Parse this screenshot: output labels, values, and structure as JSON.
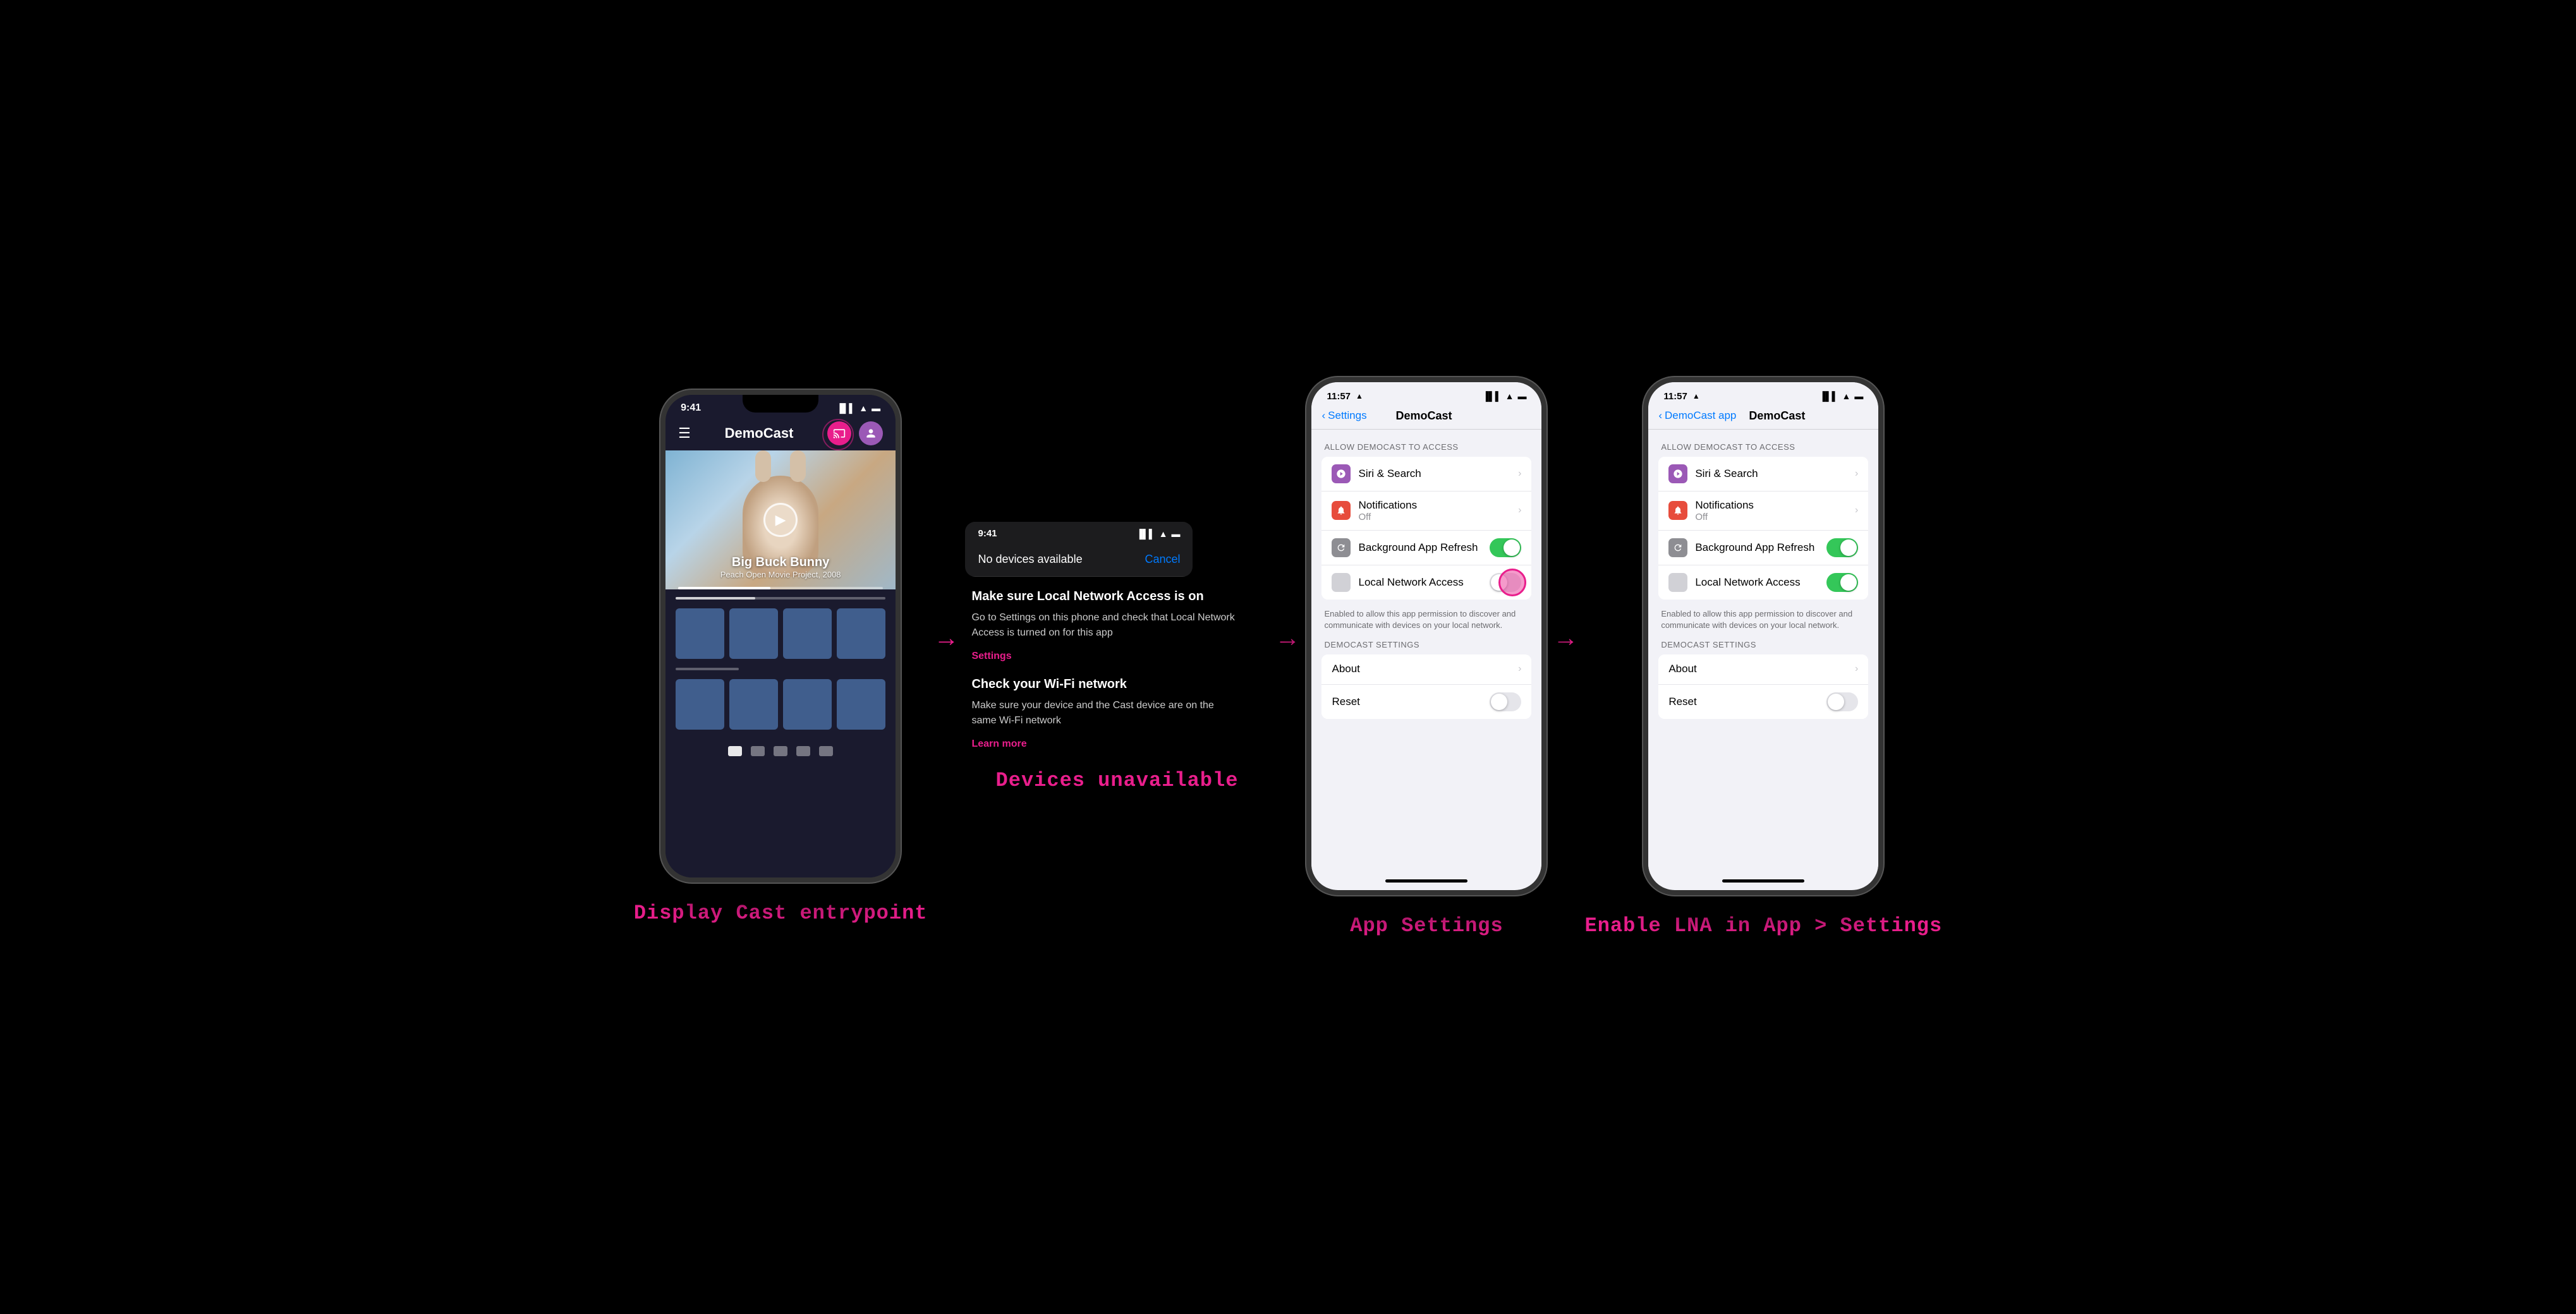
{
  "screen1": {
    "status_time": "9:41",
    "app_title": "DemoCast",
    "hero_title": "Big Buck Bunny",
    "hero_subtitle": "Peach Open Movie Project, 2008",
    "caption": "Display Cast entrypoint"
  },
  "screen2": {
    "status_time": "9:41",
    "no_devices_label": "No devices available",
    "cancel_label": "Cancel",
    "instruction1_title": "Make sure Local Network Access is on",
    "instruction1_text": "Go to Settings on this phone and check that Local Network Access is turned on for this app",
    "instruction1_link": "Settings",
    "instruction2_title": "Check your Wi-Fi network",
    "instruction2_text": "Make sure your device and the Cast device are on the same Wi-Fi network",
    "instruction2_link": "Learn more",
    "caption": "Devices unavailable"
  },
  "screen3": {
    "status_time": "11:57",
    "back_label": "Settings",
    "nav_title": "DemoCast",
    "section_allow": "ALLOW DEMOCAST TO ACCESS",
    "row_siri": "Siri & Search",
    "row_notifications": "Notifications",
    "row_notifications_sub": "Off",
    "row_background": "Background App Refresh",
    "row_lna": "Local Network Access",
    "lna_helper": "Enabled to allow this app permission to discover and communicate with devices on your local network.",
    "section_settings": "DEMOCAST SETTINGS",
    "row_about": "About",
    "row_reset": "Reset",
    "caption": "App Settings"
  },
  "screen4": {
    "status_time": "11:57",
    "back_label": "DemoCast app",
    "nav_title": "DemoCast",
    "section_allow": "ALLOW DEMOCAST TO ACCESS",
    "row_siri": "Siri & Search",
    "row_notifications": "Notifications",
    "row_notifications_sub": "Off",
    "row_background": "Background App Refresh",
    "row_lna": "Local Network Access",
    "lna_helper": "Enabled to allow this app permission to discover and communicate with devices on your local network.",
    "section_settings": "DEMOCAST SETTINGS",
    "row_about": "About",
    "row_reset": "Reset",
    "caption": "Enable LNA in App > Settings"
  },
  "icons": {
    "siri_color": "#9b59b6",
    "notifications_color": "#e74c3c",
    "background_color": "#8e8e93",
    "lna_color": "#d1d1d6"
  }
}
